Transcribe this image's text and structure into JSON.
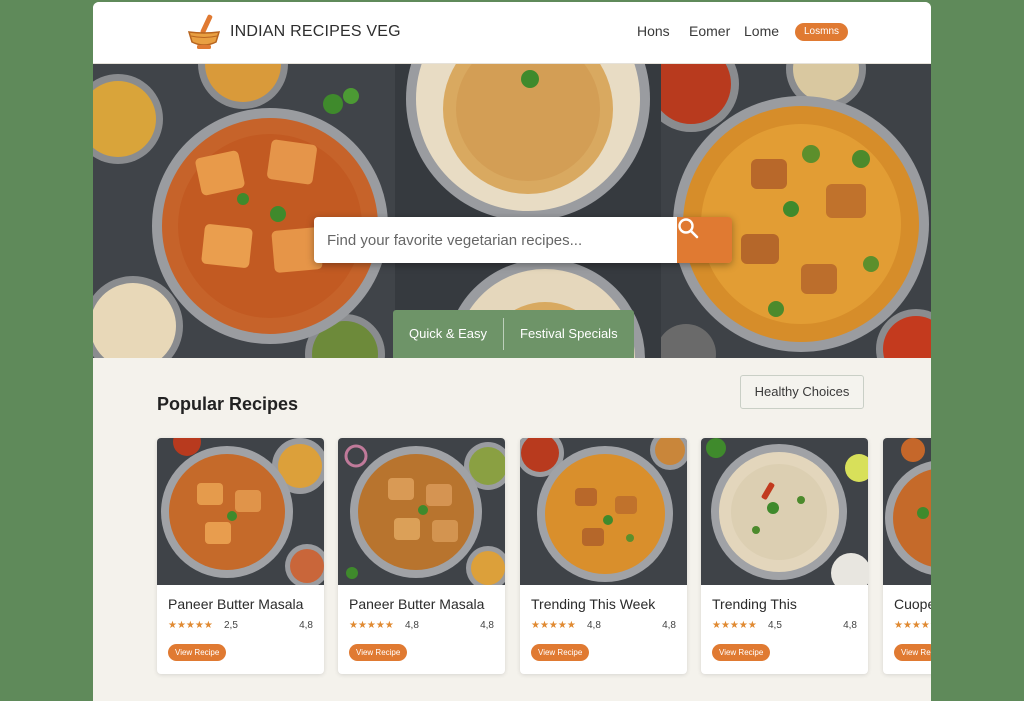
{
  "header": {
    "brand": "INDIAN RECIPES VEG",
    "nav": [
      "Hons",
      "Eomer",
      "Lome"
    ],
    "cta": "Losmns"
  },
  "hero": {
    "search_placeholder": "Find your favorite vegetarian recipes...",
    "chips": [
      "Quick & Easy",
      "Festival Specials"
    ]
  },
  "main": {
    "section_title": "Popular Recipes",
    "healthy_button": "Healthy Choices",
    "cards": [
      {
        "title": "Paneer Butter Masala",
        "stars": "★★★★★",
        "rating": "2,5",
        "rating_right": "4,8",
        "button": "View Recipe"
      },
      {
        "title": "Paneer Butter Masala",
        "stars": "★★★★★",
        "rating": "4,8",
        "rating_right": "4,8",
        "button": "View Recipe"
      },
      {
        "title": "Trending This Week",
        "stars": "★★★★★",
        "rating": "4,8",
        "rating_right": "4,8",
        "button": "View Recipe"
      },
      {
        "title": "Trending This",
        "stars": "★★★★★",
        "rating": "4,5",
        "rating_right": "4,8",
        "button": "View Recipe"
      },
      {
        "title": "Cuope",
        "stars": "★★★★★",
        "rating": "",
        "rating_right": "",
        "button": "View Re"
      }
    ]
  },
  "colors": {
    "accent": "#e07a32",
    "green": "#6e9468",
    "background": "#5f8a5a"
  }
}
